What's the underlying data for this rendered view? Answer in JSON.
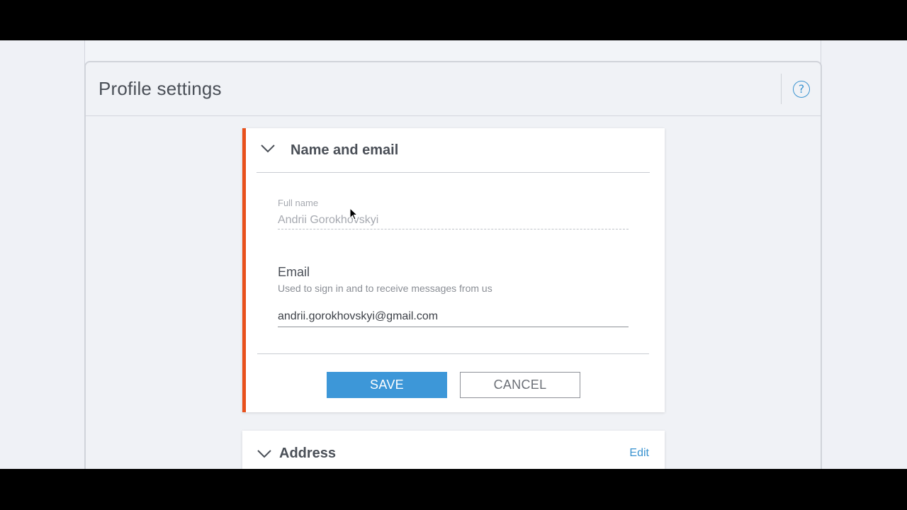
{
  "panel": {
    "title": "Profile settings",
    "help_label": "?"
  },
  "name_email": {
    "title": "Name and email",
    "full_name_label": "Full name",
    "full_name_value": "Andrii Gorokhovskyi",
    "email_label": "Email",
    "email_help": "Used to sign in and to receive messages from us",
    "email_value": "andrii.gorokhovskyi@gmail.com",
    "save_label": "SAVE",
    "cancel_label": "CANCEL"
  },
  "address": {
    "title": "Address",
    "edit_label": "Edit"
  },
  "colors": {
    "accent": "#3d97d8",
    "active_marker": "#e8501c"
  },
  "icons": {
    "help": "question-circle-icon",
    "collapse": "chevron-down-icon",
    "cursor": "mouse-pointer-icon"
  }
}
